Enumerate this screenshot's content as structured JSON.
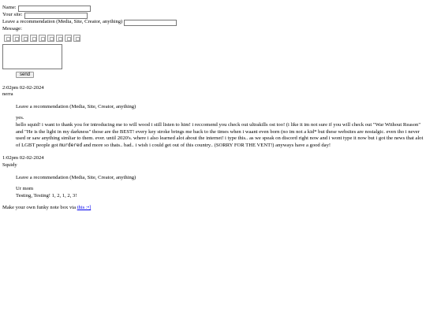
{
  "form": {
    "name_label": "Name:",
    "site_label": "Your site:",
    "rec_label": "Leave a recommendation (Media, Site, Creator, anything)",
    "message_label": "Message:",
    "send_label": "send"
  },
  "entries": [
    {
      "timestamp": "2:02pm 02-02-2024",
      "author": "nerra",
      "rec_heading": "Leave a recommendation (Media, Site, Creator, anything)",
      "rec_value": "yes.",
      "message_a": "hello squid! i want to thank you for introducing me to will wood i still listen to him! i reccomend you check out ultrakills ost too! (i like it im not sure if you will check out \"War Without Reason\" and \"He is the light in my darkness\" those are the BEST! every key stroke brings me back to the times when i waant even born (no im not a kid* but these websites are nostalgic. even tho i never used or saw anything simliar to them. ever. until 2020's. where i also learned alot about the internet! i type this.. as we speak on discord right now and i wont type it now but i got the news that alot of LGBT people got ",
      "message_mono": "murdered",
      "message_b": " and more so thats.. bad.. i wish i could get out of this country.. (SORRY FOR THE VENT!) anyways have a good day!"
    },
    {
      "timestamp": "1:02pm 02-02-2024",
      "author": "Squidy",
      "rec_heading": "Leave a recommendation (Media, Site, Creator, anything)",
      "rec_value": "Ur mom",
      "message_a": "Testing, Testing! 1, 2, 1, 2, 3!"
    }
  ],
  "footer": {
    "text": "Make your own funky note box via ",
    "link_text": "this :•]"
  }
}
